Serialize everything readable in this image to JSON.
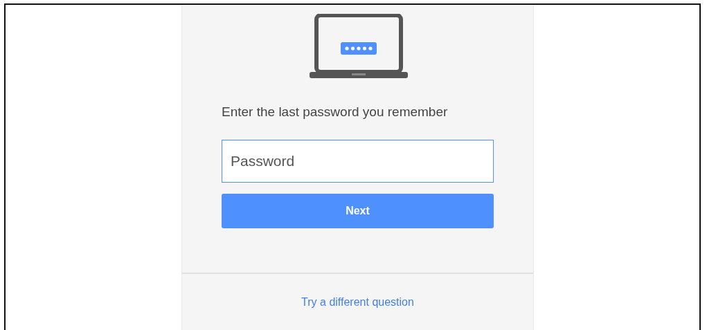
{
  "prompt": "Enter the last password you remember",
  "password_field": {
    "placeholder": "Password"
  },
  "next_button": {
    "label": "Next"
  },
  "alternate_link": "Try a different question"
}
